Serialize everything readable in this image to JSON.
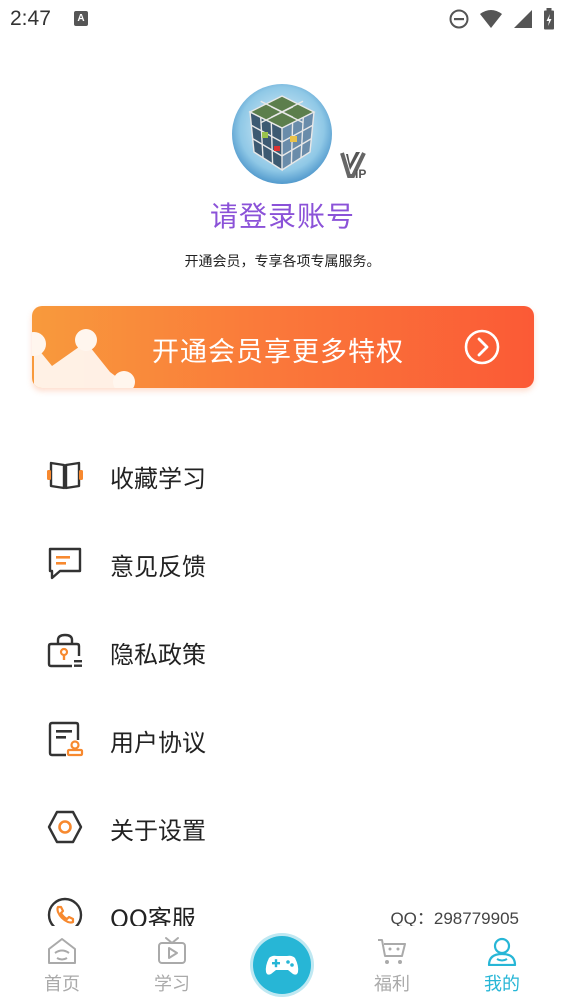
{
  "status_bar": {
    "time": "2:47",
    "notification_icon": "A"
  },
  "profile": {
    "login_prompt": "请登录账号",
    "subtitle": "开通会员，专享各项专属服务。",
    "vip_badge": "VIP"
  },
  "vip_banner": {
    "label": "开通会员享更多特权"
  },
  "menu": {
    "items": [
      {
        "label": "收藏学习",
        "icon": "book-icon"
      },
      {
        "label": "意见反馈",
        "icon": "feedback-icon"
      },
      {
        "label": "隐私政策",
        "icon": "privacy-lock-icon"
      },
      {
        "label": "用户协议",
        "icon": "agreement-icon"
      },
      {
        "label": "关于设置",
        "icon": "settings-hexagon-icon"
      },
      {
        "label": "QQ客服",
        "icon": "phone-icon",
        "extra": "QQ：298779905"
      }
    ]
  },
  "bottom_nav": {
    "items": [
      {
        "label": "首页",
        "icon": "home-icon",
        "active": false
      },
      {
        "label": "学习",
        "icon": "tv-icon",
        "active": false
      },
      {
        "label": "福利",
        "icon": "cart-icon",
        "active": false
      },
      {
        "label": "我的",
        "icon": "user-icon",
        "active": true
      }
    ],
    "center_icon": "gamepad-icon"
  },
  "colors": {
    "accent": "#27b6d6",
    "login_text": "#8b52d8",
    "banner_start": "#f89a3c",
    "banner_end": "#fb5a36",
    "icon_orange": "#f7892f"
  }
}
